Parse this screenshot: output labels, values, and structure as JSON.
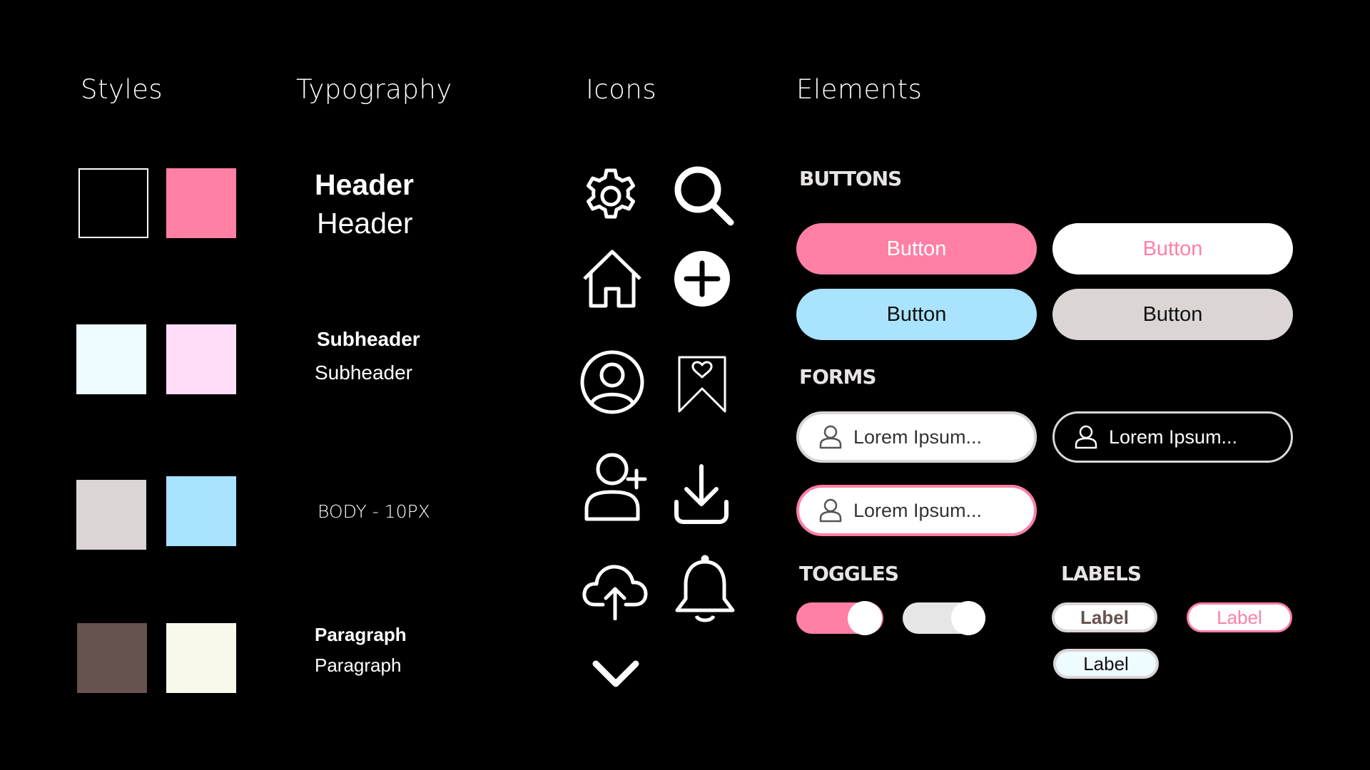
{
  "columns": {
    "styles": "Styles",
    "typography": "Typography",
    "icons": "Icons",
    "elements": "Elements"
  },
  "styles": {
    "swatches": [
      {
        "name": "black",
        "color": "#000000",
        "border": "#ffffff"
      },
      {
        "name": "pink",
        "color": "#ff7fa5"
      },
      {
        "name": "light-cyan",
        "color": "#eefbff"
      },
      {
        "name": "light-pink",
        "color": "#ffdcf8"
      },
      {
        "name": "light-gray",
        "color": "#dbd5d6"
      },
      {
        "name": "sky-blue",
        "color": "#a9e3fd"
      },
      {
        "name": "dark-brown",
        "color": "#66524f"
      },
      {
        "name": "ivory",
        "color": "#f8f9ea"
      }
    ]
  },
  "typography": {
    "header_bold": "Header",
    "header_regular": "Header",
    "subheader_bold": "Subheader",
    "subheader_regular": "Subheader",
    "body": "BODY - 10PX",
    "paragraph_bold": "Paragraph",
    "paragraph_regular": "Paragraph"
  },
  "icons": [
    "gear-icon",
    "search-icon",
    "home-icon",
    "plus-circle-icon",
    "user-circle-icon",
    "bookmark-heart-icon",
    "add-user-icon",
    "download-icon",
    "cloud-upload-icon",
    "bell-icon",
    "chevron-down-icon"
  ],
  "elements": {
    "buttons_title": "BUTTONS",
    "buttons": [
      {
        "label": "Button",
        "bg": "#ff7fa5",
        "color": "#ffffff"
      },
      {
        "label": "Button",
        "bg": "#ffffff",
        "color": "#ff7fa5"
      },
      {
        "label": "Button",
        "bg": "#a9e3fd",
        "color": "#111111"
      },
      {
        "label": "Button",
        "bg": "#dbd5d6",
        "color": "#111111"
      }
    ],
    "forms_title": "FORMS",
    "forms": [
      {
        "placeholder": "Lorem Ipsum...",
        "style": "white-fill"
      },
      {
        "placeholder": "Lorem Ipsum...",
        "style": "dark-outline"
      },
      {
        "placeholder": "Lorem Ipsum...",
        "style": "pink-outline"
      }
    ],
    "toggles_title": "TOGGLES",
    "toggles": [
      {
        "state": "on",
        "track": "#ff7fa5"
      },
      {
        "state": "off",
        "track": "#e6e6e6"
      }
    ],
    "labels_title": "LABELS",
    "labels": [
      {
        "text": "Label",
        "style": "white-bold"
      },
      {
        "text": "Label",
        "style": "pink-outline"
      },
      {
        "text": "Label",
        "style": "light-blue"
      }
    ]
  }
}
